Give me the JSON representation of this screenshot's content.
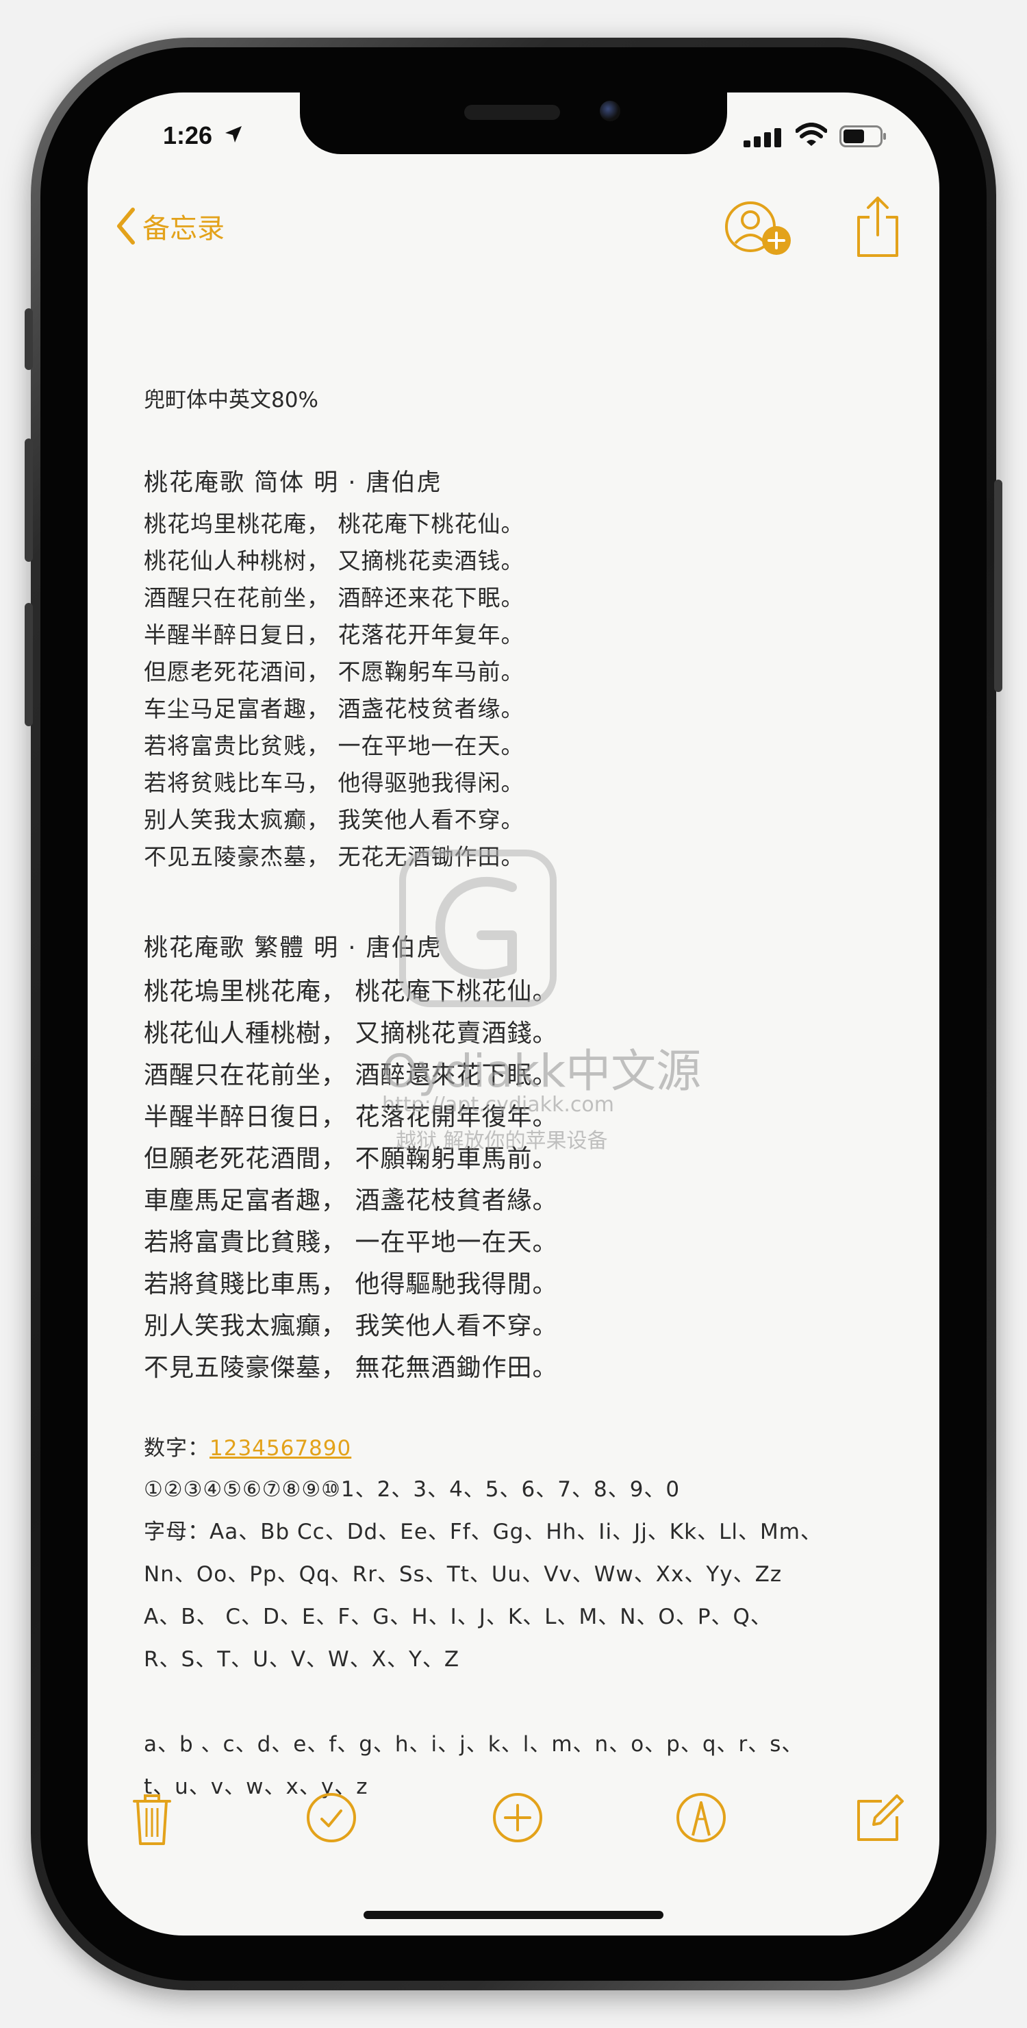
{
  "status_bar": {
    "time": "1:26"
  },
  "nav": {
    "back_label": "备忘录"
  },
  "note": {
    "meta_line": "兜町体中英文80%",
    "poem_simplified": {
      "title": "桃花庵歌   简体    明  ·  唐伯虎",
      "lines": [
        "桃花坞里桃花庵， 桃花庵下桃花仙。",
        "桃花仙人种桃树， 又摘桃花卖酒钱。",
        "酒醒只在花前坐， 酒醉还来花下眠。",
        "半醒半醉日复日， 花落花开年复年。",
        "但愿老死花酒间， 不愿鞠躬车马前。",
        "车尘马足富者趣， 酒盏花枝贫者缘。",
        "若将富贵比贫贱， 一在平地一在天。",
        "若将贫贱比车马， 他得驱驰我得闲。",
        "别人笑我太疯癫， 我笑他人看不穿。",
        "不见五陵豪杰墓， 无花无酒锄作田。"
      ]
    },
    "poem_traditional": {
      "title": "桃花庵歌  繁體       明  ·  唐伯虎",
      "lines": [
        "桃花塢里桃花庵， 桃花庵下桃花仙。",
        "桃花仙人種桃樹， 又摘桃花賣酒錢。",
        "酒醒只在花前坐， 酒醉還來花下眠。",
        "半醒半醉日復日， 花落花開年復年。",
        "但願老死花酒間， 不願鞠躬車馬前。",
        "車塵馬足富者趣， 酒盞花枝貧者緣。",
        "若將富貴比貧賤， 一在平地一在天。",
        "若將貧賤比車馬， 他得驅馳我得閒。",
        "別人笑我太瘋癲， 我笑他人看不穿。",
        "不見五陵豪傑墓， 無花無酒鋤作田。"
      ]
    },
    "digits_label": "数字：",
    "digits_link": "1234567890",
    "digits_line": "①②③④⑤⑥⑦⑧⑨⑩1、2、3、4、5、6、7、8、9、0",
    "letters_line1": "字母：Aa、Bb Cc、Dd、Ee、Ff、Gg、Hh、Ii、Jj、Kk、Ll、Mm、",
    "letters_line2": "Nn、Oo、Pp、Qq、Rr、Ss、Tt、Uu、Vv、Ww、Xx、Yy、Zz",
    "upper_line1": "A、B、 C、D、E、F、G、H、I、J、K、L、M、N、O、P、Q、",
    "upper_line2": "R、S、T、U、V、W、X、Y、Z",
    "lower_line1": "a、b 、c、d、e、f、g、h、i、j、k、l、m、n、o、p、q、r、s、",
    "lower_line2": "t、u、v、w、x、y、z"
  },
  "watermark": {
    "line1": "Oydiakk中文源",
    "line2": "http://apt.cydiakk.com",
    "line3": "越狱  解放你的苹果设备"
  },
  "colors": {
    "accent": "#e3a21a",
    "text": "#2b2b2b",
    "background": "#f7f7f5"
  },
  "icons": {
    "back": "chevron-left-icon",
    "contact": "add-person-icon",
    "share": "share-icon",
    "trash": "trash-icon",
    "checklist": "checkmark-circle-icon",
    "add": "plus-circle-icon",
    "markup": "markup-pen-icon",
    "compose": "compose-icon"
  }
}
